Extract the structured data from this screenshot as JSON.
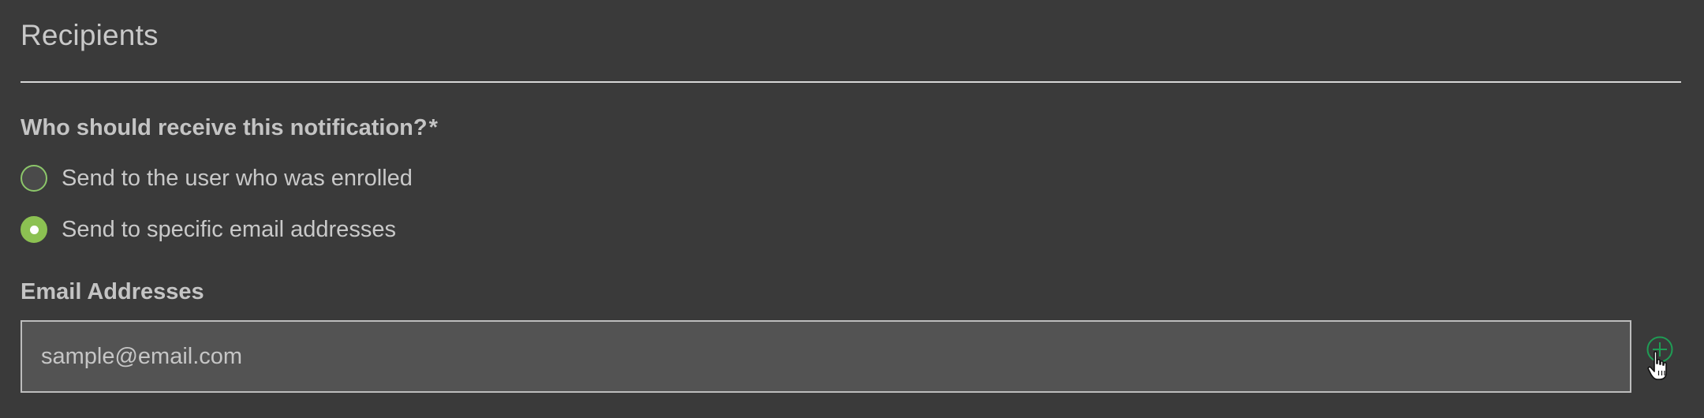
{
  "section": {
    "title": "Recipients"
  },
  "recipients": {
    "question": "Who should receive this notification?",
    "required_mark": "*",
    "options": [
      {
        "label": "Send to the user who was enrolled",
        "selected": false
      },
      {
        "label": "Send to specific email addresses",
        "selected": true
      }
    ]
  },
  "email": {
    "label": "Email Addresses",
    "placeholder": "sample@email.com",
    "value": ""
  },
  "icons": {
    "add": "plus-circle-icon",
    "cursor": "hand-pointer-cursor"
  },
  "colors": {
    "background": "#3a3a3a",
    "accent_green": "#8cc152",
    "add_icon_green": "#1f9d55",
    "input_background": "#535353",
    "text": "#c9c9c9"
  }
}
